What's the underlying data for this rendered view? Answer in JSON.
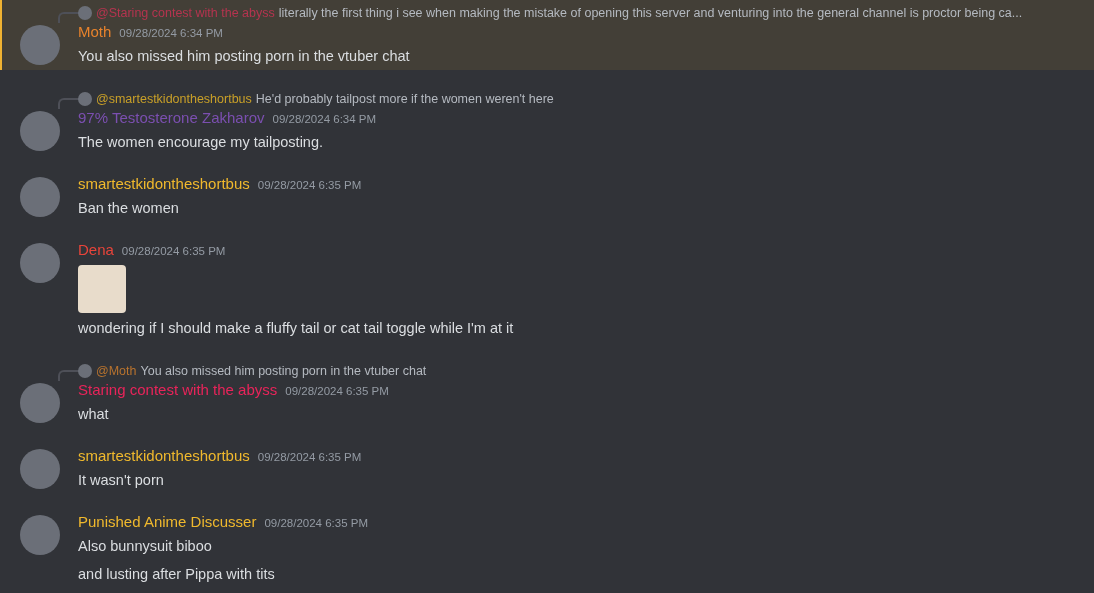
{
  "messages": [
    {
      "highlighted": true,
      "reply": {
        "author": "@Staring contest with the abyss",
        "color": "#b5344f",
        "text": "literally the first thing i see when making the mistake of opening this server and venturing into the general channel is proctor being ca..."
      },
      "author": "Moth",
      "color": "#e8832c",
      "timestamp": "09/28/2024 6:34 PM",
      "content": [
        {
          "kind": "text",
          "text": "You also missed him posting porn in the vtuber chat"
        }
      ]
    },
    {
      "highlighted": false,
      "reply": {
        "author": "@smartestkidontheshortbus",
        "color": "#c9a028",
        "text": "He'd probably tailpost more if the women weren't here"
      },
      "author": "97% Testosterone Zakharov",
      "color": "#7b4fb0",
      "timestamp": "09/28/2024 6:34 PM",
      "content": [
        {
          "kind": "text",
          "text": "The women encourage my tailposting."
        }
      ]
    },
    {
      "highlighted": false,
      "author": "smartestkidontheshortbus",
      "color": "#f0b92d",
      "timestamp": "09/28/2024 6:35 PM",
      "content": [
        {
          "kind": "text",
          "text": "Ban the women"
        }
      ]
    },
    {
      "highlighted": false,
      "author": "Dena",
      "color": "#e8443a",
      "timestamp": "09/28/2024 6:35 PM",
      "content": [
        {
          "kind": "sticker"
        },
        {
          "kind": "text",
          "text": "wondering if I should make a fluffy tail or cat tail toggle while I'm at it"
        }
      ]
    },
    {
      "highlighted": false,
      "reply": {
        "author": "@Moth",
        "color": "#b8732e",
        "text": "You also missed him posting porn in the vtuber chat"
      },
      "author": "Staring contest with the abyss",
      "color": "#e8245a",
      "timestamp": "09/28/2024 6:35 PM",
      "content": [
        {
          "kind": "text",
          "text": "what"
        }
      ]
    },
    {
      "highlighted": false,
      "author": "smartestkidontheshortbus",
      "color": "#f0b92d",
      "timestamp": "09/28/2024 6:35 PM",
      "content": [
        {
          "kind": "text",
          "text": "It wasn't porn"
        }
      ]
    },
    {
      "highlighted": false,
      "author": "Punished Anime Discusser",
      "color": "#f0b92d",
      "timestamp": "09/28/2024 6:35 PM",
      "content": [
        {
          "kind": "text",
          "text": "Also bunnysuit biboo"
        },
        {
          "kind": "text",
          "text": "and lusting after Pippa with tits"
        }
      ]
    }
  ]
}
